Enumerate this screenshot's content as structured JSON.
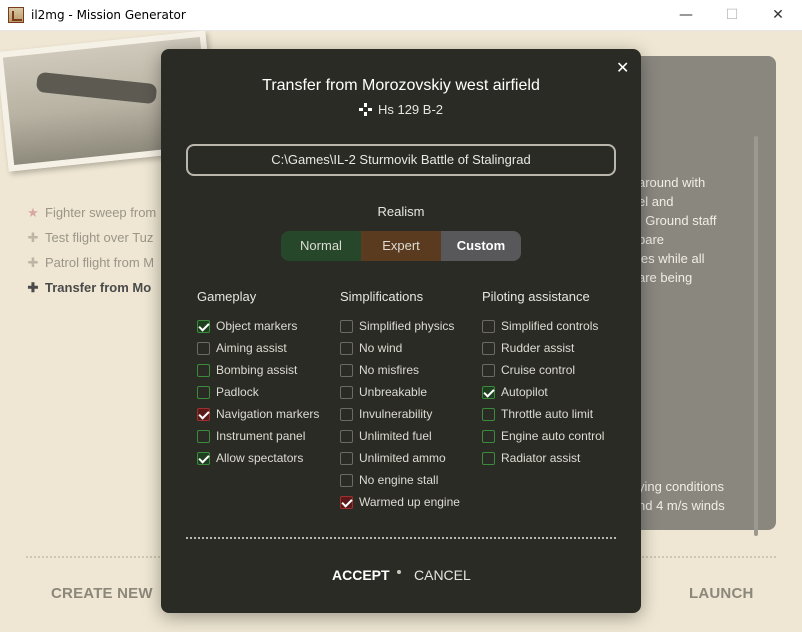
{
  "window": {
    "title": "il2mg - Mission Generator",
    "minimize_glyph": "—",
    "maximize_glyph": "☐",
    "close_glyph": "✕"
  },
  "background": {
    "missions": [
      {
        "label": "Fighter sweep from",
        "icon": "star-icon",
        "icon_glyph": "★",
        "active": false
      },
      {
        "label": "Test flight over Tuz",
        "icon": "plus-icon",
        "icon_glyph": "✚",
        "active": false
      },
      {
        "label": "Patrol flight from M",
        "icon": "plus-icon",
        "icon_glyph": "✚",
        "active": false
      },
      {
        "label": "Transfer from Mo",
        "icon": "cross-icon",
        "icon_glyph": "✚",
        "active": true
      }
    ],
    "description_lines": [
      "around with",
      "el and",
      ". Ground staff",
      "pare",
      "ies while all",
      "are being"
    ],
    "weather_lines": [
      "ying conditions",
      "nd 4 m/s winds"
    ],
    "create_new_label": "CREATE NEW",
    "launch_label": "LAUNCH"
  },
  "dialog": {
    "close_glyph": "✕",
    "title": "Transfer from Morozovskiy west airfield",
    "aircraft": "Hs 129 B-2",
    "game_path": "C:\\Games\\IL-2 Sturmovik Battle of Stalingrad",
    "realism_label": "Realism",
    "realism_options": [
      "Normal",
      "Expert",
      "Custom"
    ],
    "realism_selected": "Custom",
    "columns": {
      "gameplay": {
        "heading": "Gameplay",
        "options": [
          {
            "label": "Object markers",
            "checked": true,
            "style": "green"
          },
          {
            "label": "Aiming assist",
            "checked": false,
            "style": "grey"
          },
          {
            "label": "Bombing assist",
            "checked": false,
            "style": "green"
          },
          {
            "label": "Padlock",
            "checked": false,
            "style": "green"
          },
          {
            "label": "Navigation markers",
            "checked": true,
            "style": "red"
          },
          {
            "label": "Instrument panel",
            "checked": false,
            "style": "green"
          },
          {
            "label": "Allow spectators",
            "checked": true,
            "style": "green"
          }
        ]
      },
      "simplifications": {
        "heading": "Simplifications",
        "options": [
          {
            "label": "Simplified physics",
            "checked": false,
            "style": "grey"
          },
          {
            "label": "No wind",
            "checked": false,
            "style": "grey"
          },
          {
            "label": "No misfires",
            "checked": false,
            "style": "grey"
          },
          {
            "label": "Unbreakable",
            "checked": false,
            "style": "grey"
          },
          {
            "label": "Invulnerability",
            "checked": false,
            "style": "grey"
          },
          {
            "label": "Unlimited fuel",
            "checked": false,
            "style": "grey"
          },
          {
            "label": "Unlimited ammo",
            "checked": false,
            "style": "grey"
          },
          {
            "label": "No engine stall",
            "checked": false,
            "style": "grey"
          },
          {
            "label": "Warmed up engine",
            "checked": true,
            "style": "red"
          }
        ]
      },
      "piloting": {
        "heading": "Piloting assistance",
        "options": [
          {
            "label": "Simplified controls",
            "checked": false,
            "style": "grey"
          },
          {
            "label": "Rudder assist",
            "checked": false,
            "style": "grey"
          },
          {
            "label": "Cruise control",
            "checked": false,
            "style": "grey"
          },
          {
            "label": "Autopilot",
            "checked": true,
            "style": "green"
          },
          {
            "label": "Throttle auto limit",
            "checked": false,
            "style": "green"
          },
          {
            "label": "Engine auto control",
            "checked": false,
            "style": "green"
          },
          {
            "label": "Radiator assist",
            "checked": false,
            "style": "green"
          }
        ]
      }
    },
    "accept_label": "ACCEPT",
    "cancel_label": "CANCEL"
  }
}
